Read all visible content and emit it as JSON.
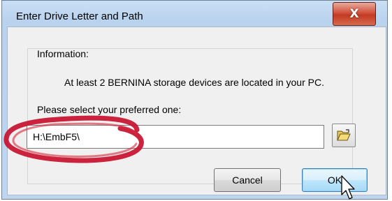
{
  "window": {
    "title": "Enter Drive Letter and Path",
    "close_glyph": "X"
  },
  "info": {
    "heading": "Information:",
    "message": "At least 2 BERNINA storage devices are located in your PC.",
    "prompt": "Please select your preferred one:"
  },
  "path_field": {
    "value": "H:\\EmbF5\\"
  },
  "browse": {
    "icon": "open-folder-icon"
  },
  "buttons": {
    "cancel_label": "Cancel",
    "ok_label": "OK"
  },
  "annotation": {
    "ring_color": "#c8102e",
    "icon": "hand-drawn-circle"
  },
  "colors": {
    "title_bar": "#bfd6ef",
    "close_button": "#c9462f",
    "dialog_background": "#f0f0f0",
    "default_button": "#bee6fd"
  }
}
